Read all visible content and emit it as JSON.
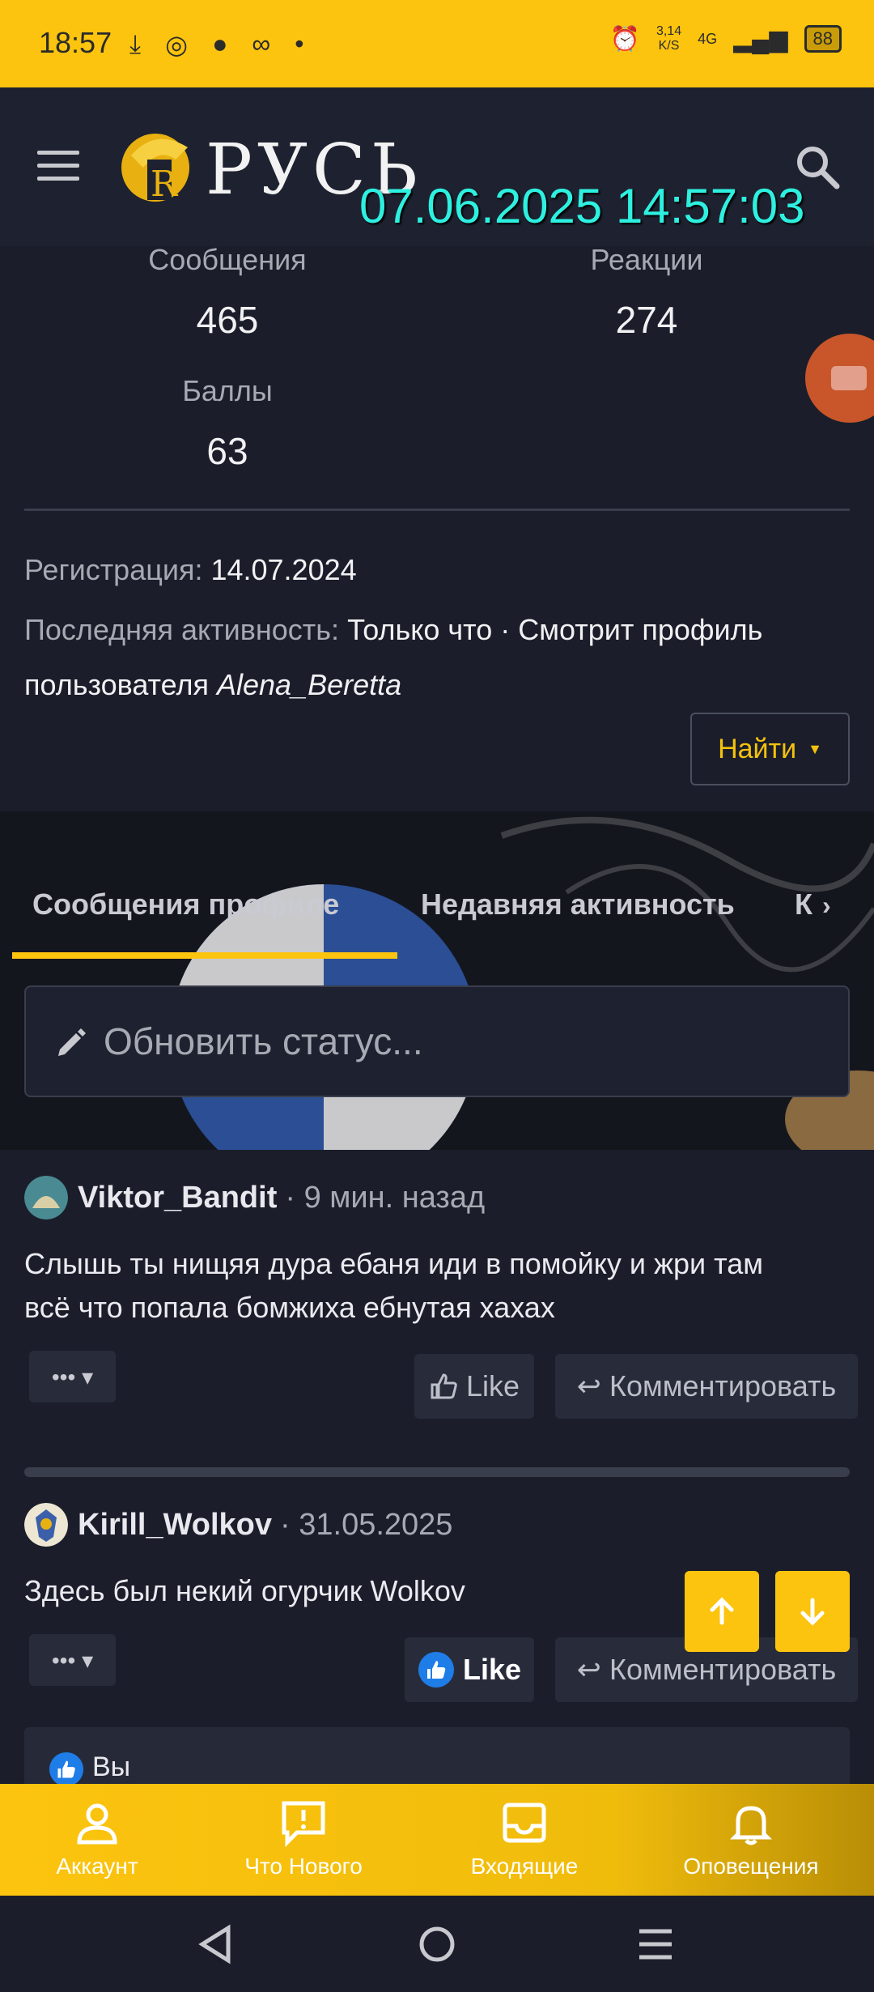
{
  "status_bar": {
    "time": "18:57",
    "icons": [
      "download-icon",
      "signal-spiral-icon",
      "chat-icon",
      "app-icon",
      "dot-icon"
    ],
    "net_speed_value": "3,14",
    "net_speed_unit": "K/S",
    "network": "4G",
    "battery": "88"
  },
  "header": {
    "logo_text": "РУСЬ",
    "clock_overlay": "07.06.2025 14:57:03"
  },
  "stats": {
    "messages_label": "Сообщения",
    "messages_value": "465",
    "reactions_label": "Реакции",
    "reactions_value": "274",
    "points_label": "Баллы",
    "points_value": "63"
  },
  "profile": {
    "reg_label": "Регистрация:",
    "reg_value": "14.07.2024",
    "activity_label": "Последняя активность:",
    "activity_value": "Только что · Смотрит профиль",
    "activity_value_2": "пользователя",
    "activity_user": "Alena_Beretta",
    "find_button": "Найти"
  },
  "tabs": {
    "tab1": "Сообщения профиле",
    "tab2": "Недавняя активность",
    "tab3": "К"
  },
  "status_input": {
    "placeholder": "Обновить статус..."
  },
  "posts": [
    {
      "author": "Viktor_Bandit",
      "time": "· 9 мин. назад",
      "body_line1": "Слышь ты нищяя дура ебаня иди в помойку и жри там",
      "body_line2": "всё что попала бомжиха ебнутая хахах",
      "like_label": "Like",
      "comment_label": "Комментировать"
    },
    {
      "author": "Kirill_Wolkov",
      "time": "· 31.05.2025",
      "body_line1": "Здесь был некий огурчик Wolkov",
      "like_label": "Like",
      "comment_label": "Комментировать",
      "reaction_text": "Вы"
    }
  ],
  "bottom_nav": {
    "account": "Аккаунт",
    "whats_new": "Что Нового",
    "inbox": "Входящие",
    "alerts": "Оповещения"
  },
  "colors": {
    "accent": "#fcc40e",
    "background": "#1b1e2a",
    "clock": "#2ef0e0"
  }
}
